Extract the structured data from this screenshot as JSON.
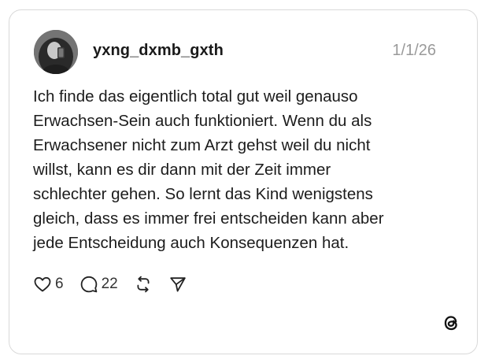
{
  "post": {
    "username": "yxng_dxmb_gxth",
    "date": "1/1/26",
    "text_lines": [
      "Ich finde das eigentlich total gut weil genauso",
      "Erwachsen-Sein auch funktioniert. Wenn du als",
      "Erwachsener nicht zum Arzt gehst weil du nicht",
      "willst, kann es dir dann mit der Zeit immer",
      "schlechter gehen. So lernt das Kind wenigstens",
      "gleich, dass es immer frei entscheiden kann aber",
      "jede Entscheidung auch Konsequenzen hat."
    ]
  },
  "actions": {
    "likes": "6",
    "replies": "22"
  },
  "icons": {
    "like": "heart-icon",
    "reply": "comment-icon",
    "repost": "repost-icon",
    "share": "send-icon",
    "brand": "threads-logo-icon"
  }
}
